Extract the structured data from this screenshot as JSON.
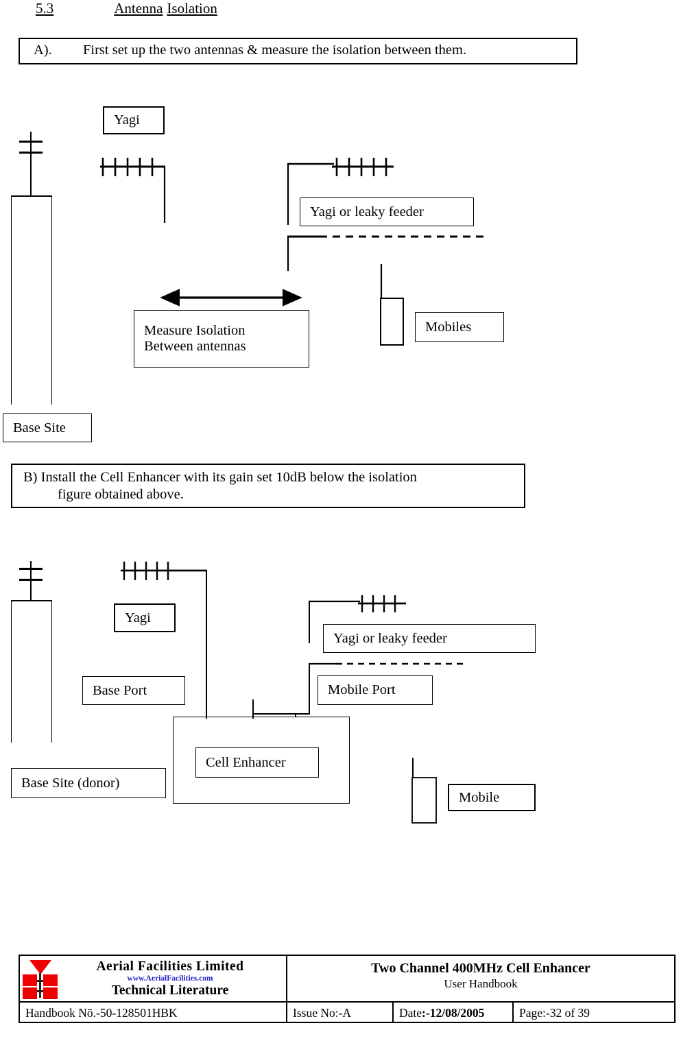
{
  "heading": {
    "number": "5.3",
    "title_part1": "Antenna",
    "title_part2": "Isolation"
  },
  "instructions": {
    "a_label": "A).",
    "a_text": "First set up the two antennas & measure the isolation between them.",
    "b_line1": "B)  Install the Cell Enhancer with its gain set 10dB below the isolation",
    "b_line2": "figure obtained above."
  },
  "diagram_a": {
    "yagi_label": "Yagi",
    "yagi_or_leaky_feeder_label": "Yagi or leaky feeder",
    "measure_line1": "Measure Isolation",
    "measure_line2": "Between antennas",
    "mobiles_label": "Mobiles",
    "base_site_label": "Base Site"
  },
  "diagram_b": {
    "yagi_label": "Yagi",
    "base_port_label": "Base Port",
    "base_site_label": "Base Site (donor)",
    "cell_enhancer_label": "Cell Enhancer",
    "yagi_or_leaky_feeder_label": "Yagi or leaky feeder",
    "mobile_port_label": "Mobile Port",
    "mobile_label": "Mobile"
  },
  "footer": {
    "company": "Aerial  Facilities  Limited",
    "url": "www.AerialFacilities.com",
    "tagline": "Technical Literature",
    "product_title": "Two Channel 400MHz Cell Enhancer",
    "product_subtitle": "User Handbook",
    "handbook": "Handbook Nō.-50-128501HBK",
    "issue": "Issue No:-A",
    "date_label": "Date",
    "date_value": ":-12/08/2005",
    "page_label": "Page",
    "page_value": ":-32 of 39",
    "logo_color": "#ee0000",
    "url_color": "#2222cc"
  }
}
